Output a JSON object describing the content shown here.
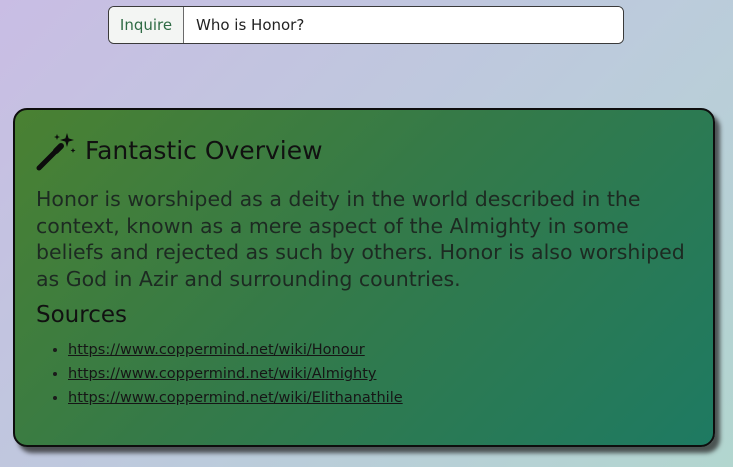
{
  "search": {
    "button_label": "Inquire",
    "value": "Who is Honor?"
  },
  "card": {
    "icon": "magic-wand-icon",
    "title": "Fantastic Overview",
    "overview": "Honor is worshiped as a deity in the world described in the context, known as a mere aspect of the Almighty in some beliefs and rejected as such by others. Honor is also worshiped as God in Azir and surrounding countries.",
    "sources_heading": "Sources",
    "sources": [
      {
        "url": "https://www.coppermind.net/wiki/Honour"
      },
      {
        "url": "https://www.coppermind.net/wiki/Almighty"
      },
      {
        "url": "https://www.coppermind.net/wiki/Elithanathile"
      }
    ]
  },
  "colors": {
    "accent_text": "#2f6b45",
    "card_gradient_start": "#4a8132",
    "card_gradient_end": "#1e7a62"
  }
}
